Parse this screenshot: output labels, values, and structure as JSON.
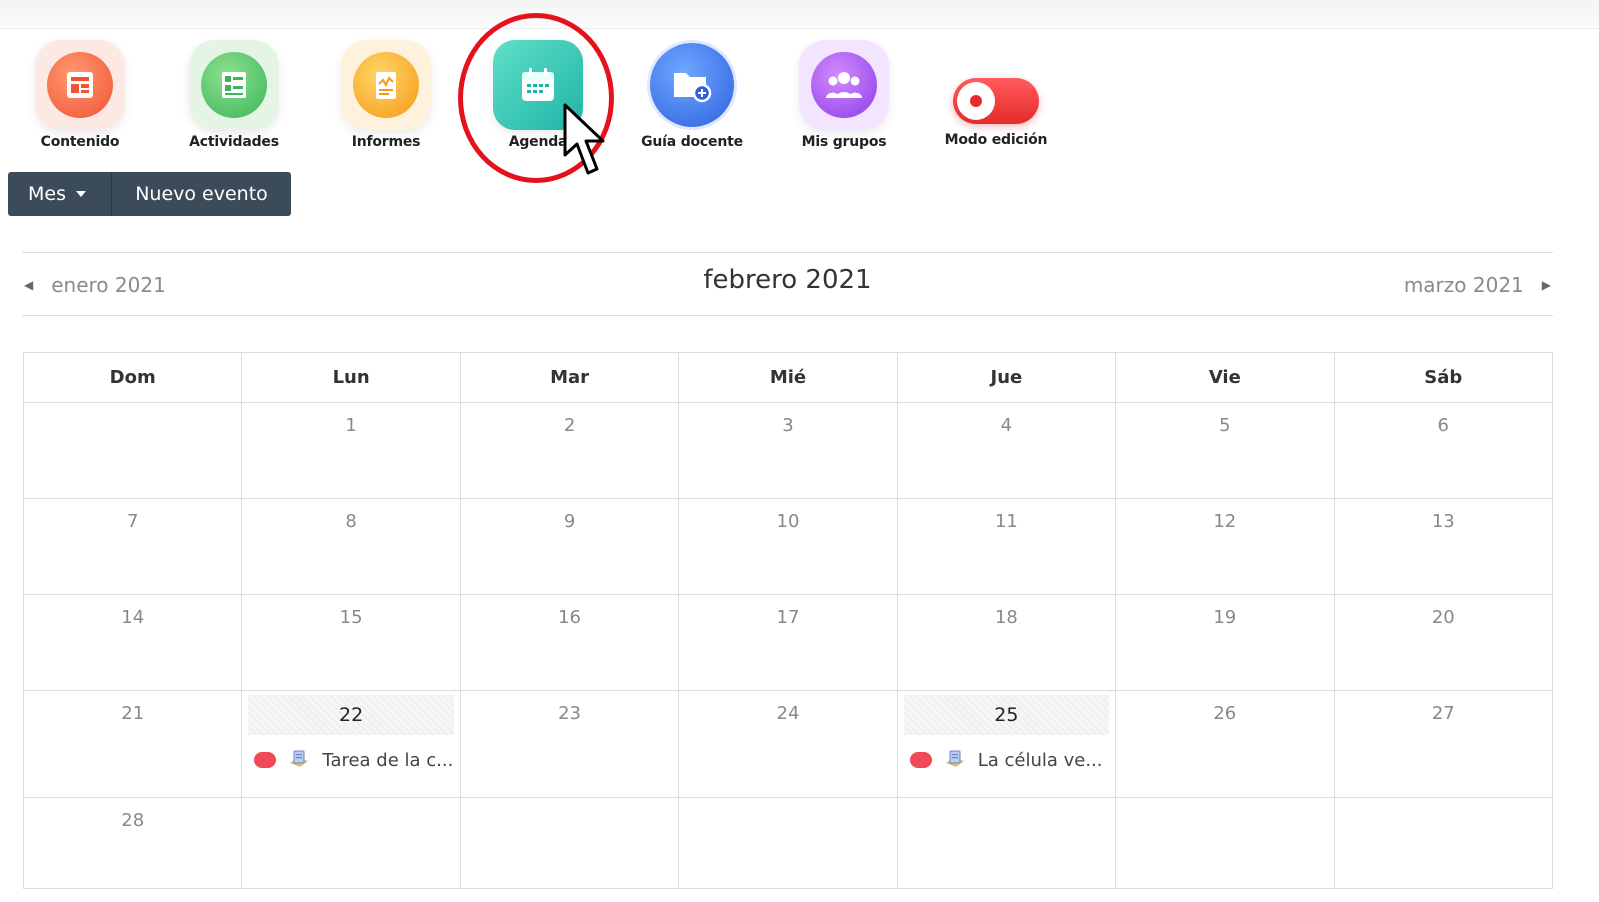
{
  "toolbar": {
    "items": [
      {
        "label": "Contenido",
        "icon": "content-icon"
      },
      {
        "label": "Actividades",
        "icon": "activities-icon"
      },
      {
        "label": "Informes",
        "icon": "reports-icon"
      },
      {
        "label": "Agenda",
        "icon": "calendar-icon"
      },
      {
        "label": "Guía docente",
        "icon": "folder-add-icon"
      },
      {
        "label": "Mis grupos",
        "icon": "group-icon"
      },
      {
        "label": "Modo edición",
        "icon": "toggle-icon",
        "state": "on"
      }
    ],
    "highlight_color": "#e3121c"
  },
  "actions": {
    "view_label": "Mes",
    "new_event_label": "Nuevo evento"
  },
  "month_nav": {
    "prev": "enero 2021",
    "current": "febrero 2021",
    "next": "marzo 2021"
  },
  "calendar": {
    "weekdays": [
      "Dom",
      "Lun",
      "Mar",
      "Mié",
      "Jue",
      "Vie",
      "Sáb"
    ],
    "weeks": [
      [
        "",
        "1",
        "2",
        "3",
        "4",
        "5",
        "6"
      ],
      [
        "7",
        "8",
        "9",
        "10",
        "11",
        "12",
        "13"
      ],
      [
        "14",
        "15",
        "16",
        "17",
        "18",
        "19",
        "20"
      ],
      [
        "21",
        "22",
        "23",
        "24",
        "25",
        "26",
        "27"
      ],
      [
        "28",
        "",
        "",
        "",
        "",
        "",
        ""
      ]
    ],
    "events": [
      {
        "day": "22",
        "title": "Tarea de la c...",
        "color": "#ee4a55",
        "icon": "assignment-icon"
      },
      {
        "day": "25",
        "title": "La célula ve...",
        "color": "#ee4a55",
        "icon": "assignment-icon"
      }
    ]
  }
}
